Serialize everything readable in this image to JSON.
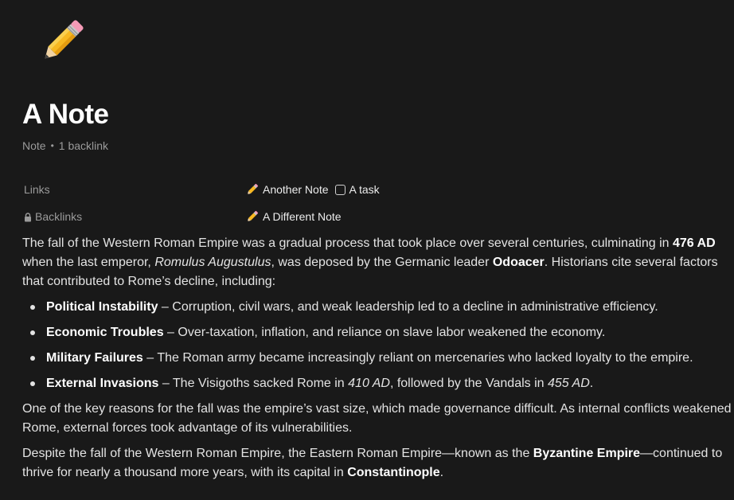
{
  "page": {
    "icon": "pencil-emoji-icon",
    "title": "A Note",
    "meta": {
      "type": "Note",
      "separator": "•",
      "backlinks": "1 backlink"
    }
  },
  "properties": {
    "links": {
      "label": "Links",
      "items": [
        {
          "icon": "pencil-emoji-icon",
          "label": "Another Note"
        },
        {
          "icon": "checkbox-icon",
          "label": "A task"
        }
      ]
    },
    "backlinks": {
      "label": "Backlinks",
      "icon": "lock-icon",
      "items": [
        {
          "icon": "pencil-emoji-icon",
          "label": "A Different Note"
        }
      ]
    }
  },
  "body": {
    "p1": {
      "t1": "The fall of the Western Roman Empire was a gradual process that took place over several centuries, culminating in ",
      "b1": "476 AD",
      "t2": " when the last emperor, ",
      "i1": "Romulus Augustulus",
      "t3": ", was deposed by the Germanic leader ",
      "b2": "Odoacer",
      "t4": ". Historians cite several factors that contributed to Rome’s decline, including:"
    },
    "list": [
      {
        "bold": "Political Instability",
        "text": " – Corruption, civil wars, and weak leadership led to a decline in administrative efficiency."
      },
      {
        "bold": "Economic Troubles",
        "text": " – Over-taxation, inflation, and reliance on slave labor weakened the economy."
      },
      {
        "bold": "Military Failures",
        "text": " – The Roman army became increasingly reliant on mercenaries who lacked loyalty to the empire."
      },
      {
        "bold": "External Invasions",
        "text": " – The Visigoths sacked Rome in ",
        "i1": "410 AD",
        "text2": ", followed by the Vandals in ",
        "i2": "455 AD",
        "text3": "."
      }
    ],
    "p2": "One of the key reasons for the fall was the empire’s vast size, which made governance difficult. As internal conflicts weakened Rome, external forces took advantage of its vulnerabilities.",
    "p3": {
      "t1": "Despite the fall of the Western Roman Empire, the Eastern Roman Empire—known as the ",
      "b1": "Byzantine Empire",
      "t2": "—continued to thrive for nearly a thousand more years, with its capital in ",
      "b2": "Constantinople",
      "t3": "."
    }
  },
  "colors": {
    "background": "#191919",
    "text": "#e3e3e3",
    "muted": "#9b9b9b"
  }
}
